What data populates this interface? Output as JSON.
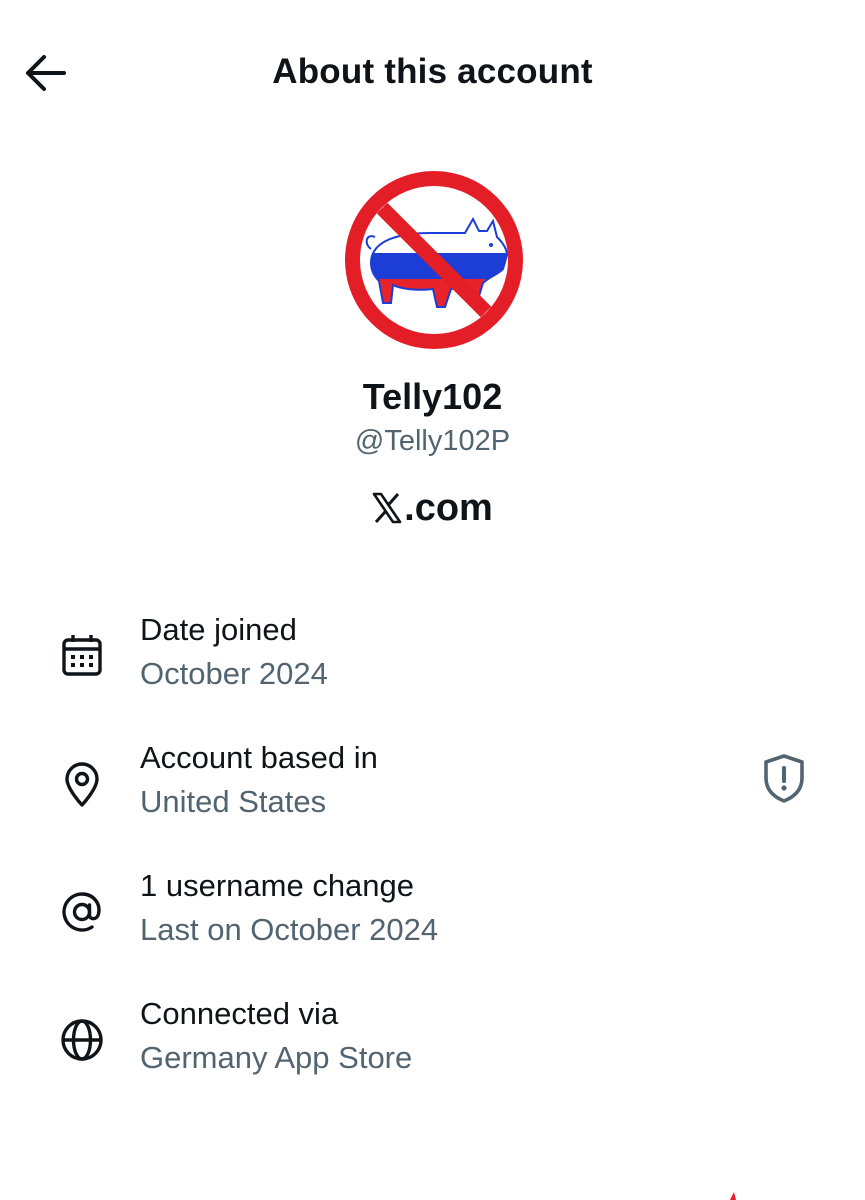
{
  "header": {
    "title": "About this account",
    "back_icon": "arrow-left-icon"
  },
  "profile": {
    "display_name": "Telly102",
    "handle": "@Telly102P",
    "site": ".com",
    "site_logo": "x-logo-icon",
    "avatar": "no-pig-russian-flag-sign"
  },
  "details": [
    {
      "icon": "calendar-icon",
      "label": "Date joined",
      "value": "October 2024"
    },
    {
      "icon": "location-pin-icon",
      "label": "Account based in",
      "value": "United States",
      "badge_icon": "shield-exclamation-icon"
    },
    {
      "icon": "at-sign-icon",
      "label": "1 username change",
      "value": "Last on October 2024"
    },
    {
      "icon": "globe-icon",
      "label": "Connected via",
      "value": "Germany App Store"
    }
  ],
  "colors": {
    "text_primary": "#0f1419",
    "text_secondary": "#536471",
    "prohibit_red": "#e41e26",
    "flag_white": "#ffffff",
    "flag_blue": "#1d3ed6",
    "flag_red": "#e8232a"
  }
}
